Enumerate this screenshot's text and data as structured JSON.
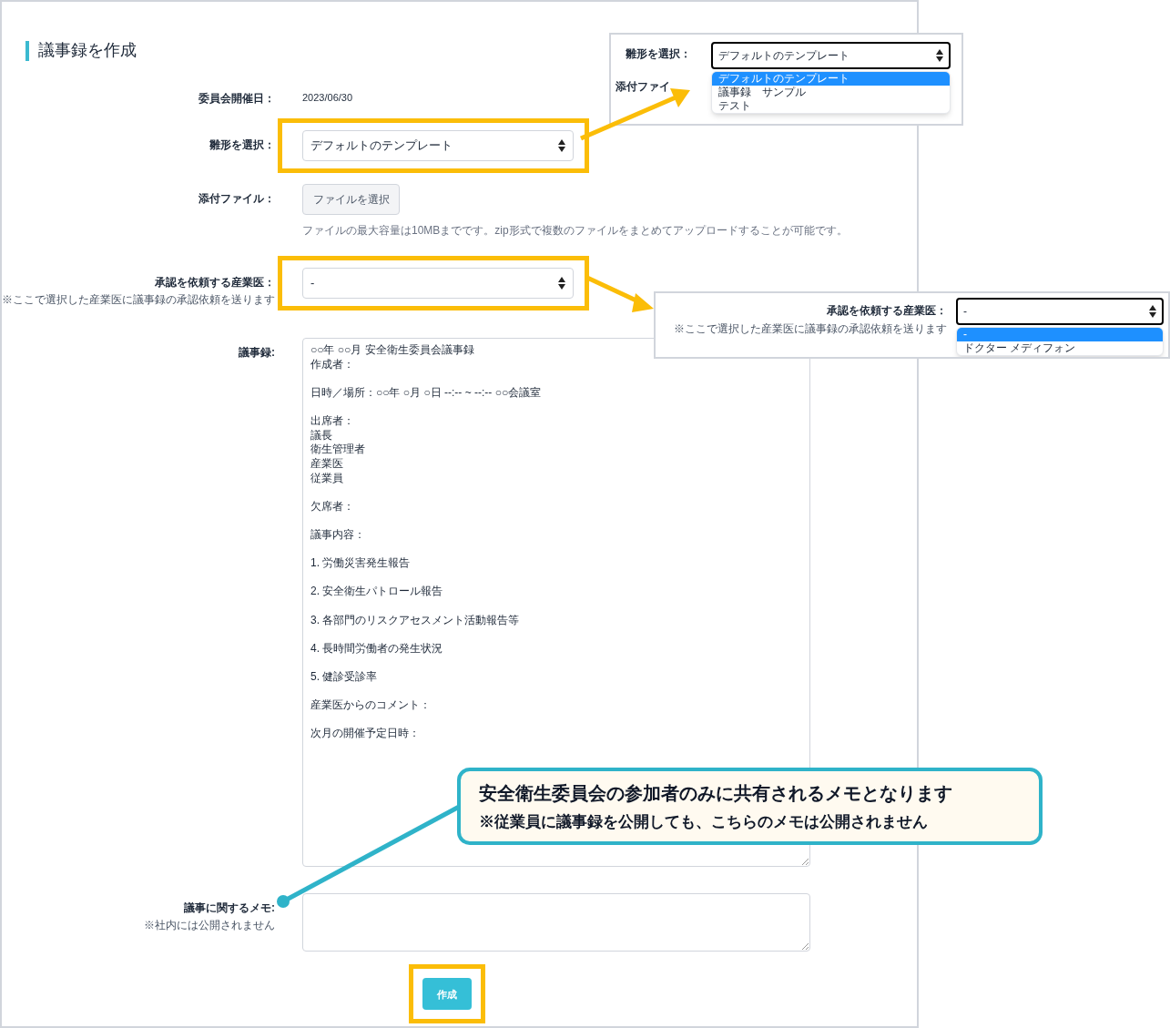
{
  "page_title": "議事録を作成",
  "fields": [
    {
      "kind": "text",
      "label": "委員会開催日：",
      "value": "2023/06/30",
      "highlighted": false
    },
    {
      "kind": "select",
      "label": "雛形を選択：",
      "value": "デフォルトのテンプレート",
      "highlighted": true
    },
    {
      "kind": "file",
      "label": "添付ファイル：",
      "button": "ファイルを選択",
      "hint": "ファイルの最大容量は10MBまでです。zip形式で複数のファイルをまとめてアップロードすることが可能です。",
      "highlighted": false
    },
    {
      "kind": "select",
      "label": "承認を依頼する産業医：",
      "note": "※ここで選択した産業医に議事録の承認依頼を送ります",
      "value": "-",
      "highlighted": true
    },
    {
      "kind": "textarea",
      "label": "議事録:",
      "paragraphs": [
        [
          "○○年 ○○月 安全衛生委員会議事録",
          "作成者："
        ],
        [
          "日時／場所：○○年 ○月 ○日 --:-- ~ --:-- ○○会議室"
        ],
        [
          "出席者：",
          "議長",
          "衛生管理者",
          "産業医",
          "従業員"
        ],
        [
          "欠席者："
        ],
        [
          "議事内容："
        ],
        [
          "1. 労働災害発生報告"
        ],
        [
          "2. 安全衛生パトロール報告"
        ],
        [
          "3. 各部門のリスクアセスメント活動報告等"
        ],
        [
          "4. 長時間労働者の発生状況"
        ],
        [
          "5. 健診受診率"
        ],
        [
          "産業医からのコメント："
        ],
        [
          "次月の開催予定日時："
        ]
      ],
      "highlighted": false
    },
    {
      "kind": "memo",
      "label": "議事に関するメモ:",
      "note": "※社内には公開されません",
      "highlighted": false
    }
  ],
  "submit": {
    "label": "作成",
    "highlighted": true
  },
  "insets": [
    {
      "label": "雛形を選択：",
      "value": "デフォルトのテンプレート",
      "partial_label": "添付ファイ",
      "options": [
        {
          "label": "デフォルトのテンプレート",
          "selected": true
        },
        {
          "label": "議事録　サンプル",
          "selected": false
        },
        {
          "label": "テスト",
          "selected": false
        }
      ]
    },
    {
      "label": "承認を依頼する産業医：",
      "note": "※ここで選択した産業医に議事録の承認依頼を送ります",
      "value": "-",
      "options": [
        {
          "label": "-",
          "selected": true
        },
        {
          "label": "ドクター メディフォン",
          "selected": false
        }
      ]
    }
  ],
  "callout": {
    "title": "安全衛生委員会の参加者のみに共有されるメモとなります",
    "note": "※従業員に議事録を公開しても、こちらのメモは公開されません"
  }
}
